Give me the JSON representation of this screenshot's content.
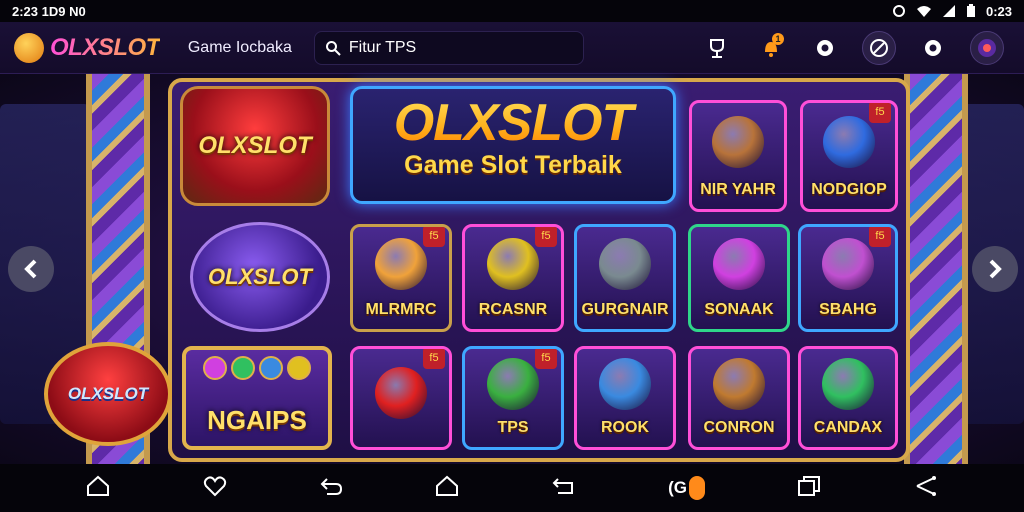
{
  "status_bar": {
    "time_left": "2:23 1D9 N0",
    "time_right": "0:23"
  },
  "header": {
    "logo_text": "OLXSLOT",
    "title": "Game Iocbaka",
    "search": {
      "value": "Fitur TPS",
      "placeholder": ""
    },
    "notification_count": "1"
  },
  "hero": {
    "title": "OLXSLOT",
    "subtitle": "Game Slot Terbaik"
  },
  "brand_badges": [
    "OLXSLOT",
    "OLXSLOT",
    "OLXSLOT",
    "NGAIPS"
  ],
  "tiles": [
    {
      "name": "NIR YAHR",
      "accent": "#b8733a",
      "corner": ""
    },
    {
      "name": "NODGIOP",
      "accent": "#2f6be0",
      "corner": "f5"
    },
    {
      "name": "MLRMRC",
      "accent": "#f0a23a",
      "corner": "f5"
    },
    {
      "name": "RCASNR",
      "accent": "#e0c020",
      "corner": "f5"
    },
    {
      "name": "GURGNAIR",
      "accent": "#7a8a90",
      "corner": ""
    },
    {
      "name": "SONAAK",
      "accent": "#d040e0",
      "corner": ""
    },
    {
      "name": "SBAHG",
      "accent": "#c050d0",
      "corner": "f5"
    },
    {
      "name": "",
      "accent": "#e02020",
      "corner": "f5"
    },
    {
      "name": "TPS",
      "accent": "#3ab040",
      "corner": "f5"
    },
    {
      "name": "ROOK",
      "accent": "#3a8ae0",
      "corner": ""
    },
    {
      "name": "CONRON",
      "accent": "#c07a30",
      "corner": ""
    },
    {
      "name": "CANDAX",
      "accent": "#30c060",
      "corner": ""
    }
  ],
  "nav_bar": {
    "center_badge": "(G"
  },
  "colors": {
    "gold": "#e3b44d",
    "purple": "#3a1d72",
    "blue_glow": "#3fa7ff",
    "brand_pink": "#ff4fd8"
  },
  "icons": [
    "home-icon",
    "heart-icon",
    "back-icon",
    "house-icon",
    "recent-icon",
    "windows-icon",
    "share-icon"
  ]
}
